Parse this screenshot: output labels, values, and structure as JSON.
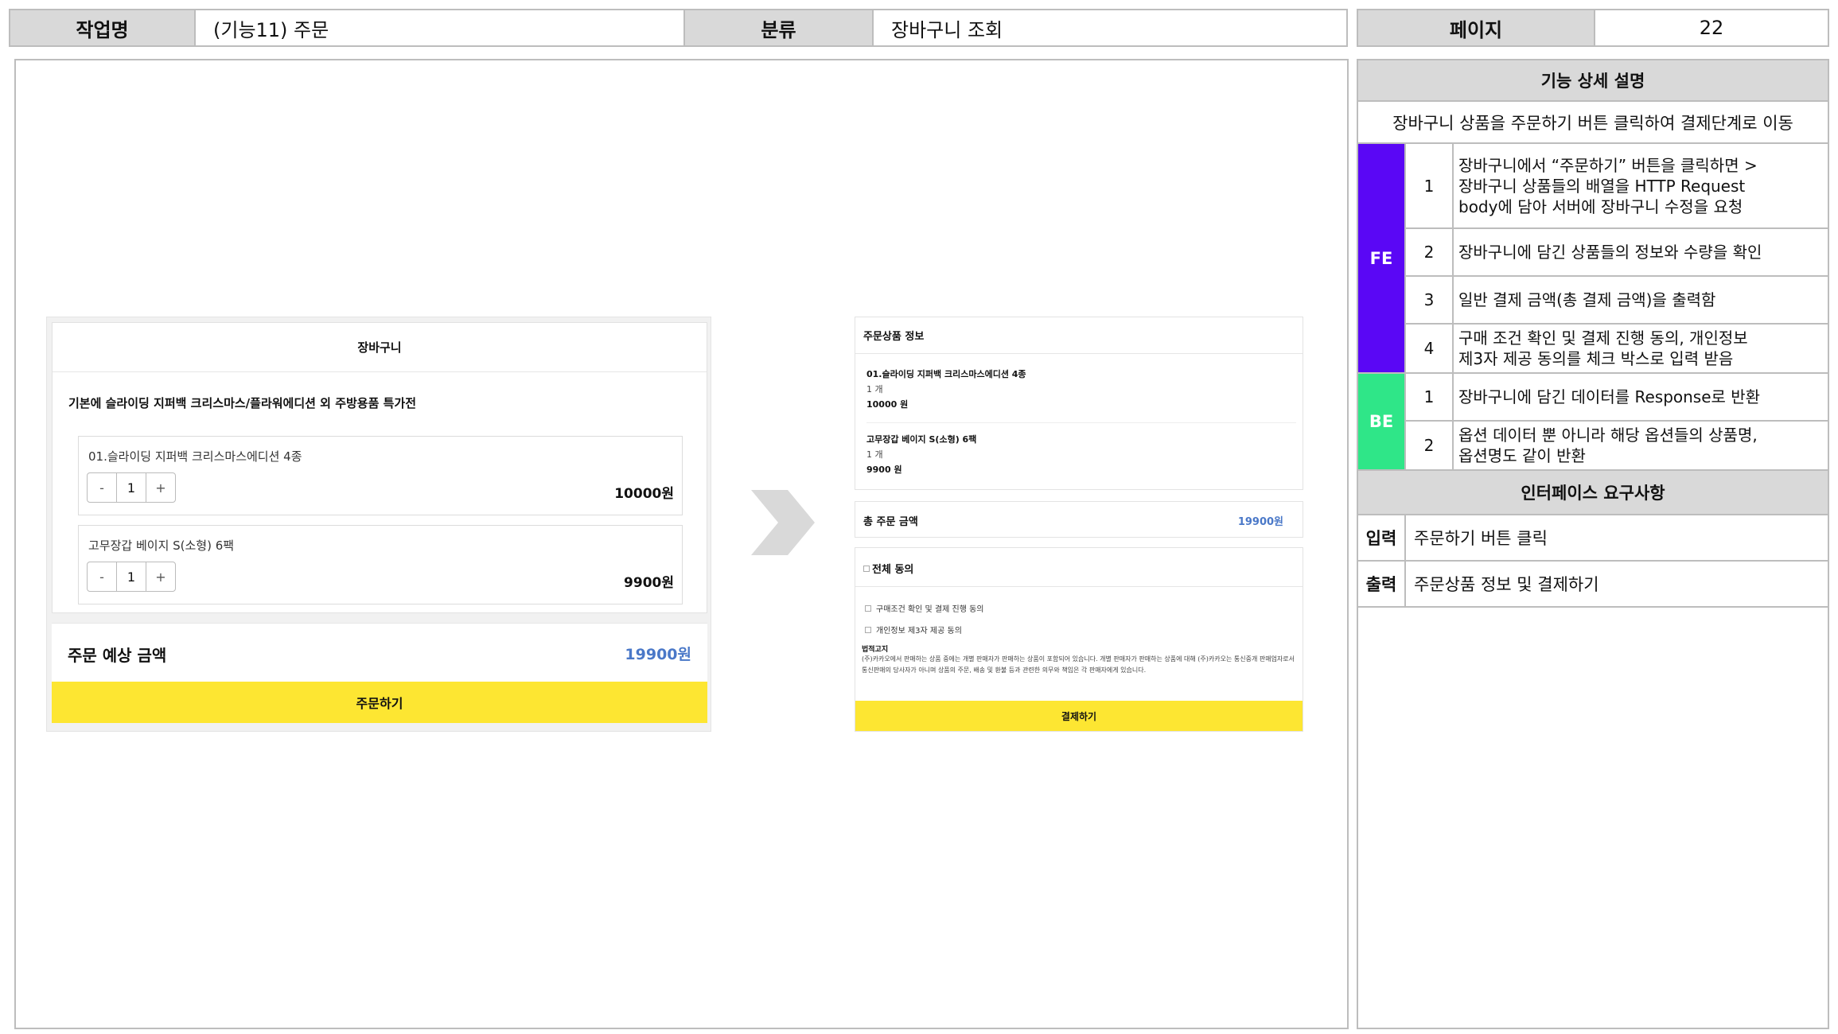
{
  "header": {
    "job_label": "작업명",
    "job_value": "(기능11) 주문",
    "category_label": "분류",
    "category_value": "장바구니 조회",
    "page_label": "페이지",
    "page_value": "22"
  },
  "cart": {
    "title": "장바구니",
    "promo": "기본에 슬라이딩 지퍼백 크리스마스/플라워에디션 외 주방용품 특가전",
    "items": [
      {
        "name": "01.슬라이딩 지퍼백 크리스마스에디션 4종",
        "qty": "1",
        "price": "10000원"
      },
      {
        "name": "고무장갑 베이지 S(소형) 6팩",
        "qty": "1",
        "price": "9900원"
      }
    ],
    "minus_label": "-",
    "plus_label": "+",
    "sum_label": "주문 예상 금액",
    "sum_value": "19900원",
    "order_button": "주문하기"
  },
  "arrow_icon": "chevron-right-icon",
  "payment": {
    "info_title": "주문상품 정보",
    "items": [
      {
        "name": "01.슬라이딩 지퍼백 크리스마스에디션 4종",
        "qty": "1 개",
        "price": "10000 원"
      },
      {
        "name": "고무장갑 베이지 S(소형) 6팩",
        "qty": "1 개",
        "price": "9900 원"
      }
    ],
    "total_label": "총 주문 금액",
    "total_value": "19900원",
    "agree_all": "전체 동의",
    "agree_purchase": "구매조건 확인 및 결제 진행 동의",
    "agree_privacy": "개인정보 제3자 제공 동의",
    "law_title": "법적고지",
    "law_text": "(주)카카오에서 판매하는 상품 중에는 개별 판매자가 판매하는 상품이 포함되어 있습니다. 개별 판매자가 판매하는 상품에 대해 (주)카카오는 통신중개 판매업자로서 통신판매의 당사자가 아니며 상품의 주문, 배송 및 환불 등과 관련한 의무와 책임은 각 판매자에게 있습니다.",
    "pay_button": "결제하기"
  },
  "spec": {
    "detail_title": "기능 상세 설명",
    "summary": "장바구니 상품을 주문하기 버튼 클릭하여 결제단계로 이동",
    "fe_label": "FE",
    "be_label": "BE",
    "fe_items": [
      {
        "num": "1",
        "text": "장바구니에서 “주문하기” 버튼을 클릭하면 >\n장바구니 상품들의 배열을 HTTP Request\nbody에 담아 서버에 장바구니 수정을 요청"
      },
      {
        "num": "2",
        "text": "장바구니에 담긴 상품들의 정보와 수량을 확인"
      },
      {
        "num": "3",
        "text": "일반 결제 금액(총 결제 금액)을 출력함"
      },
      {
        "num": "4",
        "text": "구매 조건 확인 및 결제 진행 동의, 개인정보\n제3자 제공 동의를 체크 박스로 입력 받음"
      }
    ],
    "be_items": [
      {
        "num": "1",
        "text": "장바구니에 담긴 데이터를 Response로 반환"
      },
      {
        "num": "2",
        "text": "옵션 데이터 뿐 아니라 해당 옵션들의 상품명,\n옵션명도 같이 반환"
      }
    ],
    "interface_title": "인터페이스 요구사항",
    "input_label": "입력",
    "input_value": "주문하기 버튼 클릭",
    "output_label": "출력",
    "output_value": "주문상품 정보 및 결제하기"
  },
  "colors": {
    "fe": "#5a07f5",
    "be": "#2fe688",
    "button_yellow": "#fde632",
    "price_blue": "#4a78c8",
    "header_gray": "#d9d9d9"
  }
}
